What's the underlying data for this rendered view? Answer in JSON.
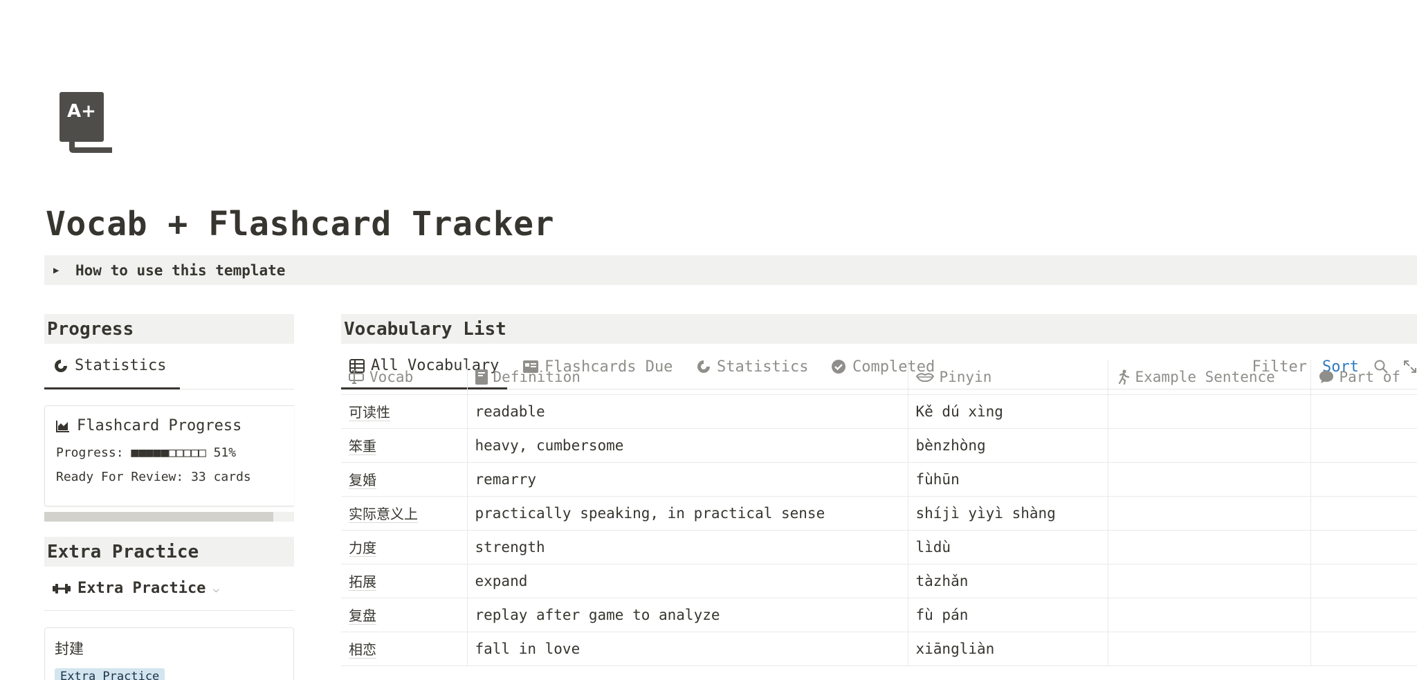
{
  "page": {
    "icon": "a-plus-document-icon",
    "title": "Vocab + Flashcard Tracker",
    "toggle": "How to use this template"
  },
  "progress_section": {
    "header": "Progress",
    "view_tab": "Statistics",
    "card": {
      "title": "Flashcard Progress",
      "progress_text": "Progress: ■■■■■□□□□□ 51%",
      "progress_percent": 51,
      "ready_text": "Ready For Review: 33 cards"
    }
  },
  "extra_section": {
    "header": "Extra Practice",
    "view_tab": "Extra Practice",
    "card": {
      "title": "封建",
      "tag": "Extra Practice"
    }
  },
  "vocab_section": {
    "header": "Vocabulary List",
    "tabs": [
      {
        "label": "All Vocabulary",
        "icon": "table-icon",
        "active": true
      },
      {
        "label": "Flashcards Due",
        "icon": "card-icon",
        "active": false
      },
      {
        "label": "Statistics",
        "icon": "pie-chart-icon",
        "active": false
      },
      {
        "label": "Completed",
        "icon": "check-circle-icon",
        "active": false
      }
    ],
    "tools": {
      "filter": "Filter",
      "sort": "Sort"
    },
    "columns": [
      {
        "label": "Vocab",
        "icon": "text-cursor-icon"
      },
      {
        "label": "Definition",
        "icon": "book-icon"
      },
      {
        "label": "Pinyin",
        "icon": "lips-icon"
      },
      {
        "label": "Example Sentence",
        "icon": "running-person-icon"
      },
      {
        "label": "Part of",
        "icon": "speech-bubble-icon"
      }
    ],
    "rows": [
      {
        "vocab": "可读性",
        "definition": "readable",
        "pinyin": "Kě dú xìng"
      },
      {
        "vocab": "笨重",
        "definition": "heavy, cumbersome",
        "pinyin": "bènzhòng"
      },
      {
        "vocab": "复婚",
        "definition": "remarry",
        "pinyin": "fùhūn"
      },
      {
        "vocab": "实际意义上",
        "definition": "practically speaking, in practical sense",
        "pinyin": "shíjì yìyì shàng"
      },
      {
        "vocab": "力度",
        "definition": "strength",
        "pinyin": "lìdù"
      },
      {
        "vocab": "拓展",
        "definition": "expand",
        "pinyin": "tàzhǎn"
      },
      {
        "vocab": "复盘",
        "definition": "replay after game to analyze",
        "pinyin": "fù pán"
      },
      {
        "vocab": "相恋",
        "definition": "fall in love",
        "pinyin": "xiāngliàn"
      }
    ]
  },
  "colors": {
    "text": "#37352f",
    "muted": "#8f8e8a",
    "header_bg": "#f1f1ef",
    "sort_accent": "#2f79bf",
    "tag_bg": "#d3e5ef"
  }
}
